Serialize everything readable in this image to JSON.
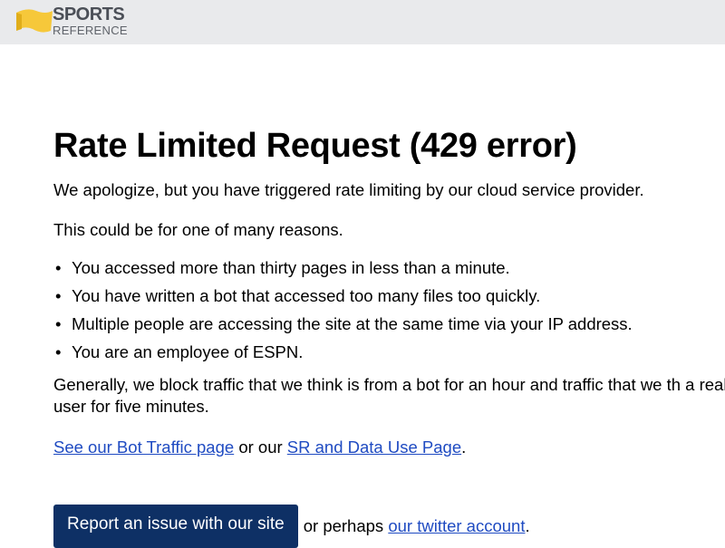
{
  "header": {
    "logo_line1": "SPORTS",
    "logo_line2": "REFERENCE",
    "logo_color": "#f6c83a",
    "background": "#e9eaec"
  },
  "main": {
    "title": "Rate Limited Request (429 error)",
    "apology": "We apologize, but you have triggered rate limiting by our cloud service provider.",
    "reasons_intro": "This could be for one of many reasons.",
    "reasons": [
      "You accessed more than thirty pages in less than a minute.",
      "You have written a bot that accessed too many files too quickly.",
      "Multiple people are accessing the site at the same time via your IP address.",
      "You are an employee of ESPN."
    ],
    "general": "Generally, we block traffic that we think is from a bot for an hour and traffic that we th a real user for five minutes.",
    "links": {
      "bot_traffic_link": "See our Bot Traffic page",
      "or_our": "or our",
      "data_use_link": "SR and Data Use Page",
      "period": "."
    },
    "actions": {
      "report_button": "Report an issue with our site",
      "or_perhaps": "or perhaps",
      "twitter_link": "our twitter account",
      "period": "."
    }
  },
  "colors": {
    "link": "#1f4bc2",
    "button_bg": "#0e3065",
    "button_text": "#ffffff"
  }
}
